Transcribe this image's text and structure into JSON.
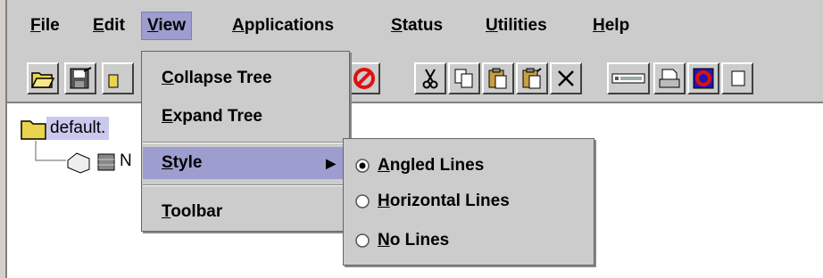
{
  "menubar": {
    "items": [
      {
        "label": "File",
        "mnemonic": "F",
        "rest": "ile"
      },
      {
        "label": "Edit",
        "mnemonic": "E",
        "rest": "dit"
      },
      {
        "label": "View",
        "mnemonic": "V",
        "rest": "iew"
      },
      {
        "label": "Applications",
        "mnemonic": "A",
        "rest": "pplications"
      },
      {
        "label": "Status",
        "mnemonic": "S",
        "rest": "tatus"
      },
      {
        "label": "Utilities",
        "mnemonic": "U",
        "rest": "tilities"
      },
      {
        "label": "Help",
        "mnemonic": "H",
        "rest": "elp"
      }
    ]
  },
  "view_menu": {
    "collapse_tree": {
      "mnemonic": "C",
      "rest": "ollapse Tree"
    },
    "expand_tree": {
      "mnemonic": "E",
      "rest": "xpand Tree"
    },
    "style": {
      "mnemonic": "S",
      "rest": "tyle",
      "arrow": "▶"
    },
    "toolbar": {
      "mnemonic": "T",
      "rest": "oolbar"
    }
  },
  "style_submenu": {
    "angled": {
      "mnemonic": "A",
      "rest": "ngled Lines",
      "selected": true
    },
    "horizontal": {
      "mnemonic": "H",
      "rest": "orizontal Lines",
      "selected": false
    },
    "none": {
      "mnemonic": "N",
      "rest": "o Lines",
      "selected": false
    }
  },
  "tree": {
    "root_label": "default.",
    "child_label_partial": "N"
  },
  "icons": {
    "toolbar": [
      "open-folder-icon",
      "save-icon",
      "open-icon",
      "stop-icon",
      "cut-icon",
      "copy-icon",
      "paste-icon",
      "paste-special-icon",
      "delete-icon",
      "console-icon",
      "printer-icon",
      "app-icon",
      "tool-icon"
    ]
  },
  "colors": {
    "menu_bg": "#cccccc",
    "selection": "#9d9dcf",
    "tree_selection": "#c9c9ef"
  }
}
